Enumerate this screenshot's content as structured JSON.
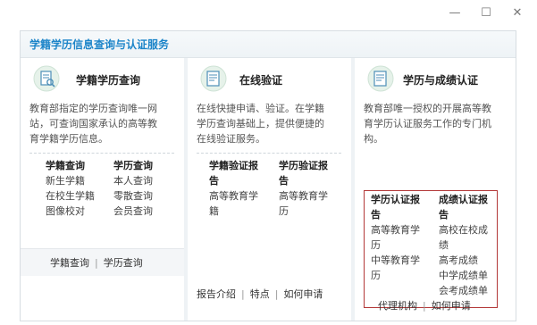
{
  "window": {
    "minimize": "—",
    "maximize": "☐",
    "close": "✕"
  },
  "panel": {
    "title": "学籍学历信息查询与认证服务"
  },
  "services": [
    {
      "title": "学籍学历查询",
      "icon": "document-search-icon",
      "desc": [
        "教育部指定的学历查询唯一网",
        "站，可查询国家承认的高等教",
        "育学籍学历信息。"
      ],
      "left": {
        "heading": "学籍查询",
        "items": [
          "新生学籍",
          "在校生学籍",
          "图像校对"
        ]
      },
      "right": {
        "heading": "学历查询",
        "items": [
          "本人查询",
          "零散查询",
          "会员查询"
        ]
      },
      "footer": [
        "学籍查询",
        "学历查询"
      ]
    },
    {
      "title": "在线验证",
      "icon": "certificate-icon",
      "desc": [
        "在线快捷申请、验证。在学籍",
        "学历查询基础上，提供便捷的",
        "在线验证服务。"
      ],
      "left": {
        "heading": [
          "学籍验证报",
          "告"
        ],
        "items": [
          "高等教育学",
          "籍"
        ]
      },
      "right": {
        "heading": [
          "学历验证报",
          "告"
        ],
        "items": [
          "高等教育学",
          "历"
        ]
      },
      "footer": [
        "报告介绍",
        "特点",
        "如何申请"
      ]
    },
    {
      "title": "学历与成绩认证",
      "icon": "certificate-icon",
      "desc": [
        "教育部唯一授权的开展高等教",
        "育学历认证服务工作的专门机",
        "构。"
      ],
      "left": {
        "heading": [
          "学历认证报",
          "告"
        ],
        "items": [
          "高等教育学",
          "历",
          "中等教育学",
          "历"
        ]
      },
      "right": {
        "heading": [
          "成绩认证报",
          "告"
        ],
        "items": [
          "高校在校成",
          "绩",
          "高考成绩",
          "中学成绩单",
          "会考成绩单"
        ]
      },
      "footer": [
        "代理机构",
        "如何申请"
      ]
    }
  ]
}
